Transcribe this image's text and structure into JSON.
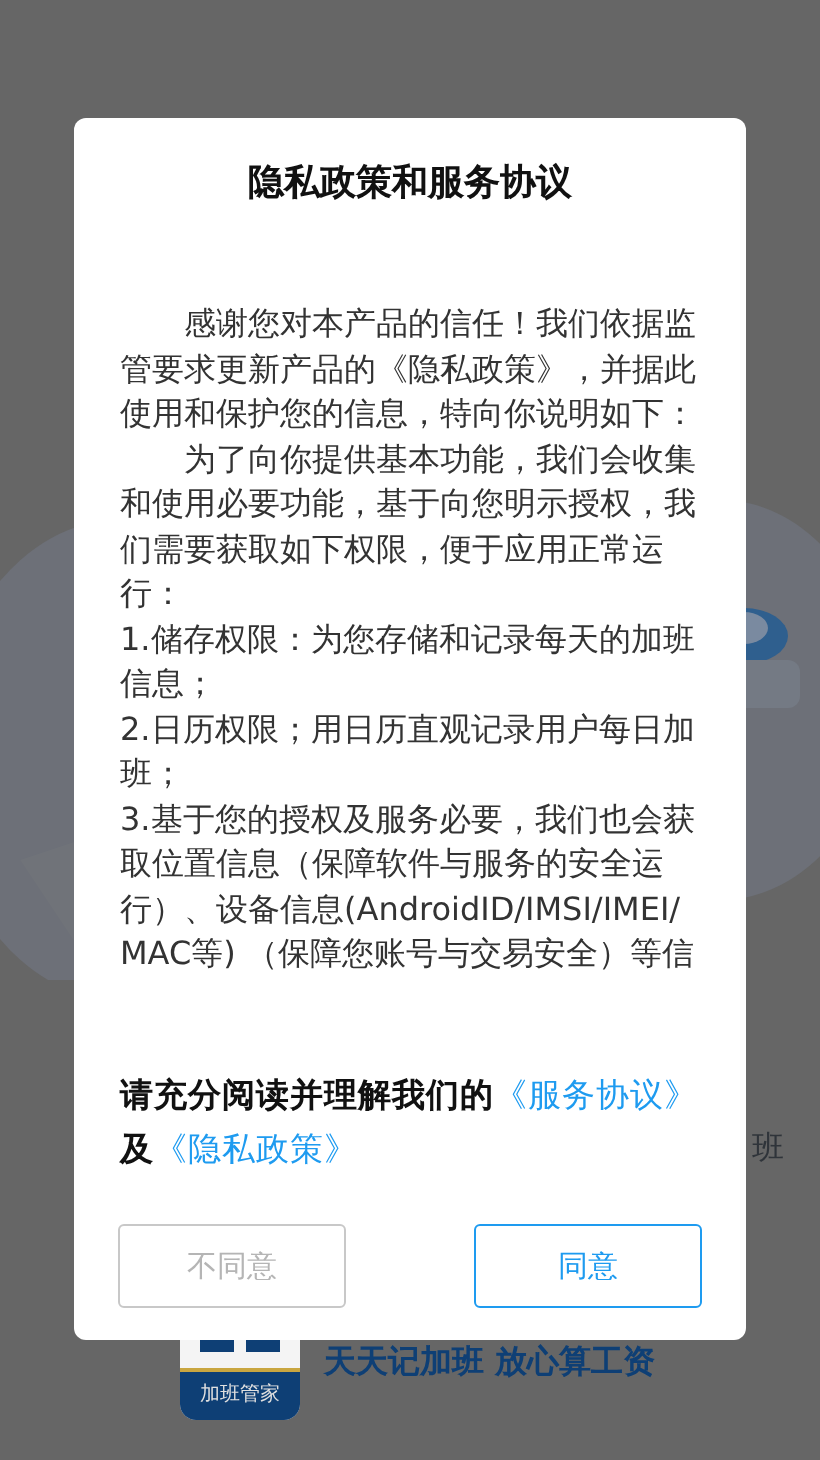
{
  "splash": {
    "side_text": "班",
    "logo_caption": "加班管家",
    "tagline": "天天记加班 放心算工资"
  },
  "dialog": {
    "title": "隐私政策和服务协议",
    "paragraphs": [
      {
        "text": "感谢您对本产品的信任！我们依据监管要求更新产品的《隐私政策》，并据此使用和保护您的信息，特向你说明如下：",
        "indent": true
      },
      {
        "text": "为了向你提供基本功能，我们会收集和使用必要功能，基于向您明示授权，我们需要获取如下权限，便于应用正常运行：",
        "indent": true
      },
      {
        "text": "1.储存权限：为您存储和记录每天的加班信息；",
        "indent": false
      },
      {
        "text": "2.日历权限；用日历直观记录用户每日加班；",
        "indent": false
      },
      {
        "text": "3.基于您的授权及服务必要，我们也会获取位置信息（保障软件与服务的安全运行）、设备信息(AndroidID/IMSI/IMEI/MAC等) （保障您账号与交易安全）等信",
        "indent": false
      }
    ],
    "notice": [
      {
        "kind": "text",
        "text": "请充分阅读并理解我们的"
      },
      {
        "kind": "link",
        "text": "《服务协议》"
      },
      {
        "kind": "text",
        "text": "及"
      },
      {
        "kind": "link",
        "text": "《隐私政策》"
      }
    ],
    "buttons": [
      {
        "label": "不同意",
        "kind": "secondary"
      },
      {
        "label": "同意",
        "kind": "primary"
      }
    ]
  }
}
